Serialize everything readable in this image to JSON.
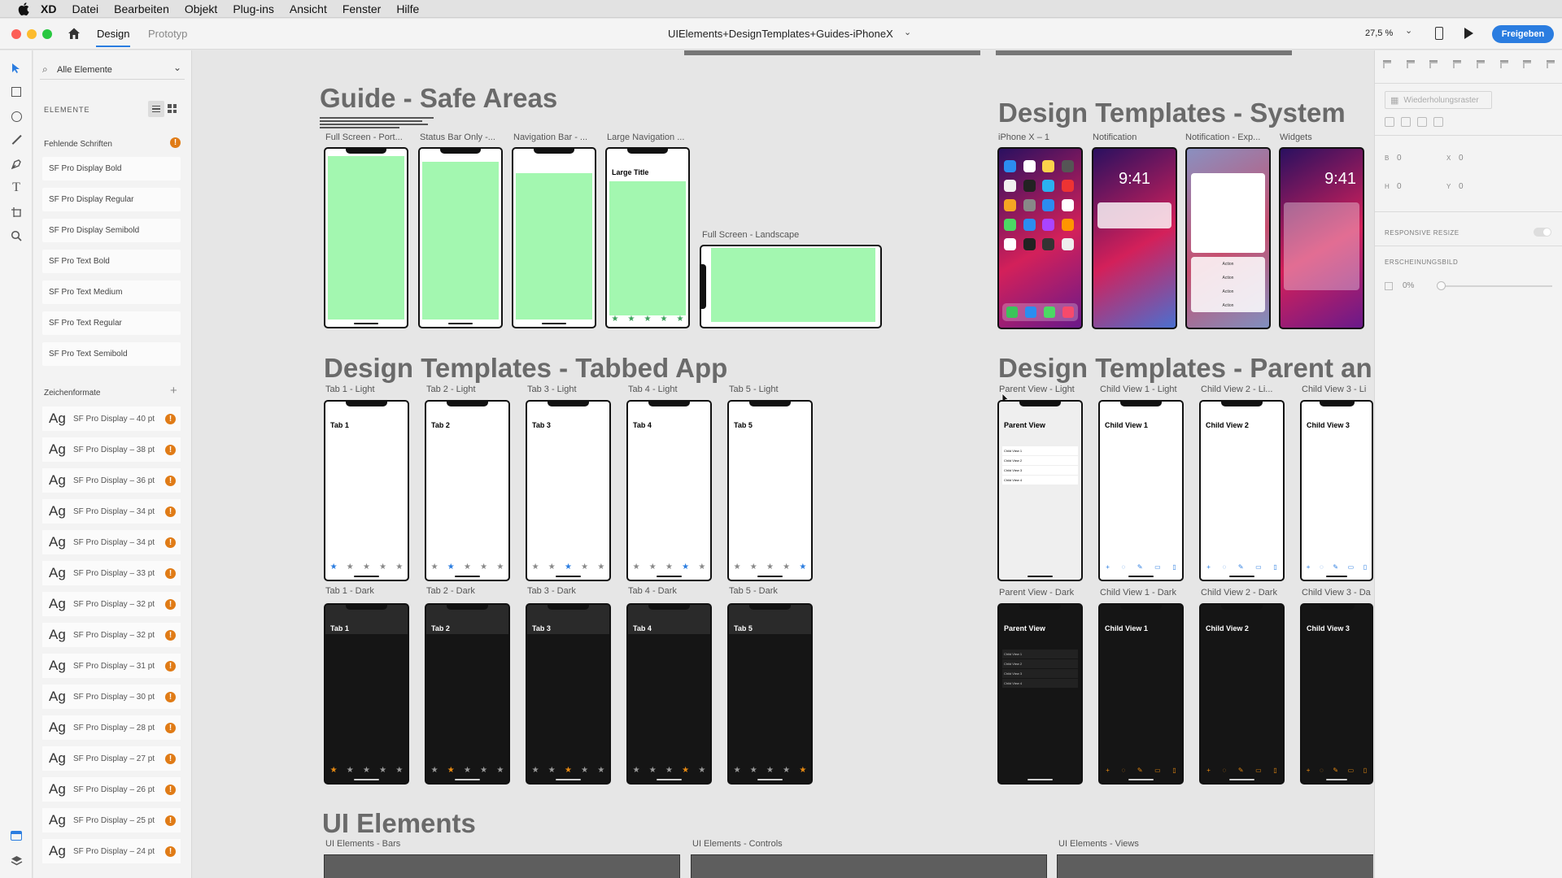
{
  "menubar": {
    "app": "XD",
    "items": [
      "Datei",
      "Bearbeiten",
      "Objekt",
      "Plug-ins",
      "Ansicht",
      "Fenster",
      "Hilfe"
    ]
  },
  "toolbar": {
    "tab_design": "Design",
    "tab_prototype": "Prototyp",
    "doc_title": "UIElements+DesignTemplates+Guides-iPhoneX",
    "zoom": "27,5 %",
    "share": "Freigeben"
  },
  "left_panel": {
    "search_label": "Alle Elemente",
    "elements_header": "ELEMENTE",
    "missing_fonts_header": "Fehlende Schriften",
    "missing_fonts": [
      "SF Pro Display Bold",
      "SF Pro Display Regular",
      "SF Pro Display Semibold",
      "SF Pro Text Bold",
      "SF Pro Text Medium",
      "SF Pro Text Regular",
      "SF Pro Text Semibold"
    ],
    "char_styles_header": "Zeichenformate",
    "char_sample": "Ag",
    "char_styles": [
      "SF Pro Display – 40 pt",
      "SF Pro Display – 38 pt",
      "SF Pro Display – 36 pt",
      "SF Pro Display – 34 pt",
      "SF Pro Display – 34 pt",
      "SF Pro Display – 33 pt",
      "SF Pro Display – 32 pt",
      "SF Pro Display – 32 pt",
      "SF Pro Display – 31 pt",
      "SF Pro Display – 30 pt",
      "SF Pro Display – 28 pt",
      "SF Pro Display – 27 pt",
      "SF Pro Display – 26 pt",
      "SF Pro Display – 25 pt",
      "SF Pro Display – 24 pt"
    ]
  },
  "canvas": {
    "guide_title": "Guide - Safe Areas",
    "guide_artboards": [
      "Full Screen - Port...",
      "Status Bar Only -...",
      "Navigation Bar - ...",
      "Large Navigation ..."
    ],
    "landscape_label": "Full Screen - Landscape",
    "large_title": "Large Title",
    "system_title": "Design Templates - System",
    "system_artboards": [
      "iPhone X – 1",
      "Notification",
      "Notification - Exp...",
      "Widgets"
    ],
    "time": "9:41",
    "action": "Action",
    "tabbed_title": "Design Templates - Tabbed App",
    "tabs_light": [
      "Tab 1 - Light",
      "Tab 2 - Light",
      "Tab 3 - Light",
      "Tab 4 - Light",
      "Tab 5 - Light"
    ],
    "tabs_dark": [
      "Tab 1 - Dark",
      "Tab 2 - Dark",
      "Tab 3 - Dark",
      "Tab 4 - Dark",
      "Tab 5 - Dark"
    ],
    "tab_names": [
      "Tab 1",
      "Tab 2",
      "Tab 3",
      "Tab 4",
      "Tab 5"
    ],
    "parent_title": "Design Templates - Parent an",
    "parent_light": [
      "Parent View - Light",
      "Child View 1 - Light",
      "Child View 2 - Li...",
      "Child View 3 - Li"
    ],
    "parent_dark": [
      "Parent View - Dark",
      "Child View 1 - Dark",
      "Child View 2 - Dark",
      "Child View 3 - Da"
    ],
    "parent_names": [
      "Parent View",
      "Child View 1",
      "Child View 2",
      "Child View 3"
    ],
    "child_list": [
      "Child View 1",
      "Child View 2",
      "Child View 3",
      "Child View 4"
    ],
    "ui_title": "UI Elements",
    "ui_artboards": [
      "UI Elements - Bars",
      "UI Elements - Controls",
      "UI Elements - Views"
    ]
  },
  "right_panel": {
    "repeat_grid": "Wiederholungsraster",
    "w_label": "B",
    "w_value": "0",
    "h_label": "H",
    "h_value": "0",
    "x_label": "X",
    "x_value": "0",
    "y_label": "Y",
    "y_value": "0",
    "responsive": "RESPONSIVE RESIZE",
    "appearance": "ERSCHEINUNGSBILD",
    "opacity": "0%"
  },
  "colors": {
    "accent": "#2b7de0",
    "safe_area": "#a3f7b0",
    "warning": "#e07b16",
    "dark_active": "#e88a12"
  }
}
